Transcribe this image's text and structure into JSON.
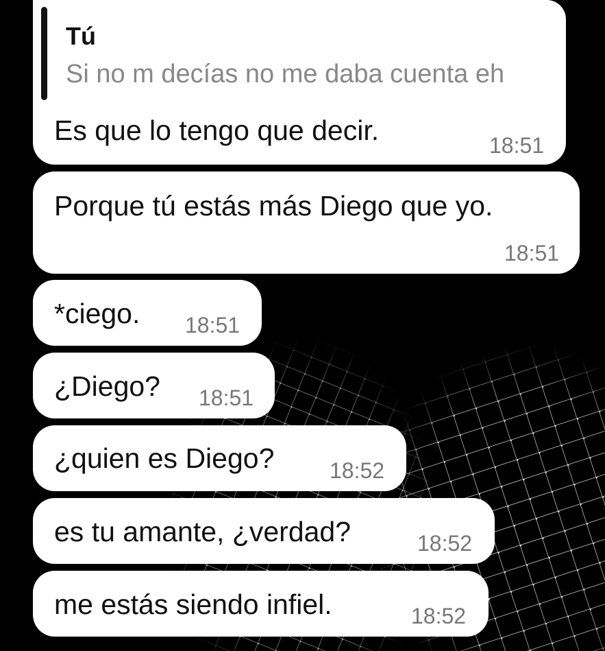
{
  "theme": {
    "background": "#000000",
    "bubble": "#ffffff",
    "text": "#111111",
    "time": "#777777",
    "quote_text": "#888888"
  },
  "messages": [
    {
      "reply_to": {
        "author": "Tú",
        "text": "Si no m decías no me daba cuenta eh"
      },
      "text": "Es que lo tengo que decir.",
      "time": "18:51"
    },
    {
      "text": "Porque tú estás más Diego que yo.",
      "time": "18:51"
    },
    {
      "text": "*ciego.",
      "time": "18:51"
    },
    {
      "text": "¿Diego?",
      "time": "18:51"
    },
    {
      "text": "¿quien es Diego?",
      "time": "18:52"
    },
    {
      "text": "es tu amante, ¿verdad?",
      "time": "18:52"
    },
    {
      "text": "me estás siendo infiel.",
      "time": "18:52"
    }
  ]
}
